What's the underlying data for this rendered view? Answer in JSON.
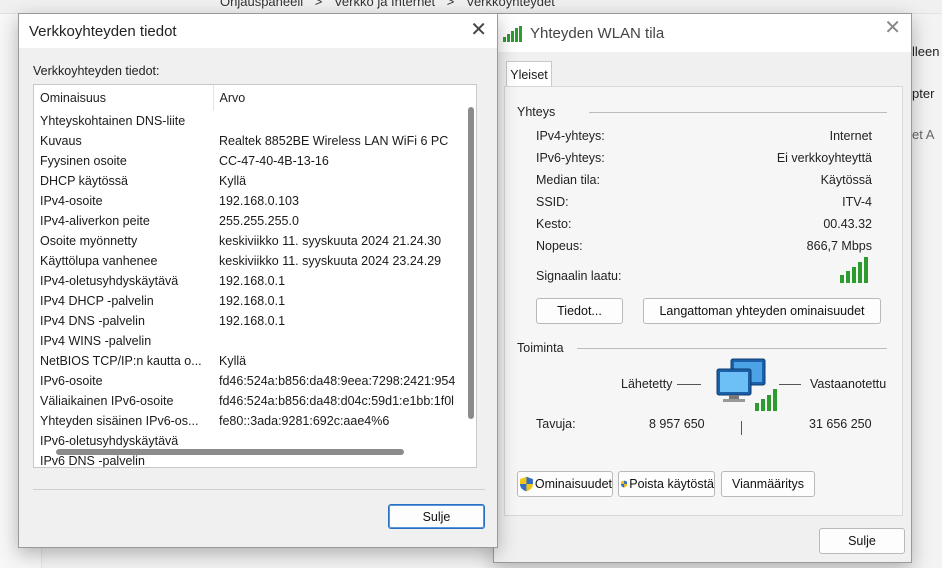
{
  "background": {
    "breadcrumb": [
      "Ohjauspaneeli",
      ">",
      "Verkko ja Internet",
      ">",
      "Verkkoyhteydet"
    ],
    "right_fragments": [
      "lleen",
      "pter",
      "et A"
    ]
  },
  "details_dialog": {
    "title": "Verkkoyhteyden tiedot",
    "group_label": "Verkkoyhteyden tiedot:",
    "columns": [
      "Ominaisuus",
      "Arvo"
    ],
    "rows": [
      {
        "property": "Yhteyskohtainen DNS-liite",
        "value": ""
      },
      {
        "property": "Kuvaus",
        "value": "Realtek 8852BE Wireless LAN WiFi 6 PC"
      },
      {
        "property": "Fyysinen osoite",
        "value": "CC-47-40-4B-13-16"
      },
      {
        "property": "DHCP käytössä",
        "value": "Kyllä"
      },
      {
        "property": "IPv4-osoite",
        "value": "192.168.0.103"
      },
      {
        "property": "IPv4-aliverkon peite",
        "value": "255.255.255.0"
      },
      {
        "property": "Osoite myönnetty",
        "value": "keskiviikko 11. syyskuuta 2024 21.24.30"
      },
      {
        "property": "Käyttölupa vanhenee",
        "value": "keskiviikko 11. syyskuuta 2024 23.24.29"
      },
      {
        "property": "IPv4-oletusyhdyskäytävä",
        "value": "192.168.0.1"
      },
      {
        "property": "IPv4 DHCP -palvelin",
        "value": "192.168.0.1"
      },
      {
        "property": "IPv4 DNS -palvelin",
        "value": "192.168.0.1"
      },
      {
        "property": "IPv4 WINS -palvelin",
        "value": ""
      },
      {
        "property": "NetBIOS TCP/IP:n kautta o...",
        "value": "Kyllä"
      },
      {
        "property": "IPv6-osoite",
        "value": "fd46:524a:b856:da48:9eea:7298:2421:954"
      },
      {
        "property": "Väliaikainen IPv6-osoite",
        "value": "fd46:524a:b856:da48:d04c:59d1:e1bb:1f0l"
      },
      {
        "property": "Yhteyden sisäinen IPv6-os...",
        "value": "fe80::3ada:9281:692c:aae4%6"
      },
      {
        "property": "IPv6-oletusyhdyskäytävä",
        "value": ""
      },
      {
        "property": "IPv6 DNS -palvelin",
        "value": ""
      }
    ],
    "close_label": "Sulje"
  },
  "status_dialog": {
    "title": "Yhteyden WLAN tila",
    "tab": "Yleiset",
    "connection_section": "Yhteys",
    "fields": [
      {
        "label": "IPv4-yhteys:",
        "value": "Internet"
      },
      {
        "label": "IPv6-yhteys:",
        "value": "Ei verkkoyhteyttä"
      },
      {
        "label": "Median tila:",
        "value": "Käytössä"
      },
      {
        "label": "SSID:",
        "value": "ITV-4"
      },
      {
        "label": "Kesto:",
        "value": "00.43.32"
      },
      {
        "label": "Nopeus:",
        "value": "866,7 Mbps"
      }
    ],
    "signal_label": "Signaalin laatu:",
    "details_button": "Tiedot...",
    "wireless_props_button": "Langattoman yhteyden ominaisuudet",
    "activity_section": "Toiminta",
    "sent_label": "Lähetetty",
    "received_label": "Vastaanotettu",
    "bytes_label": "Tavuja:",
    "bytes_sent": "8 957 650",
    "bytes_received": "31 656 250",
    "properties_button": "Ominaisuudet",
    "disable_button": "Poista käytöstä",
    "diagnose_button": "Vianmääritys",
    "close_label": "Sulje"
  },
  "colors": {
    "signal_green": "#2e9b2e",
    "accent_blue": "#2a6fbf"
  }
}
